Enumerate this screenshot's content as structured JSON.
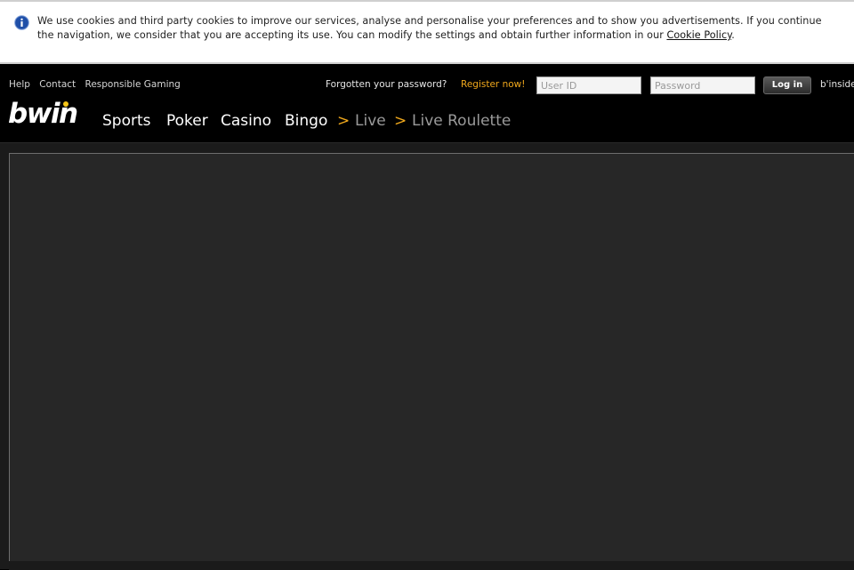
{
  "cookie_banner": {
    "text": "We use cookies and third party cookies to improve our services, analyse and personalise your preferences and to show you advertisements. If you continue the navigation, we consider that you are accepting its use. You can modify the settings and obtain further information in our ",
    "link_label": "Cookie Policy",
    "suffix": "."
  },
  "header": {
    "utility_links": [
      "Help",
      "Contact",
      "Responsible Gaming"
    ],
    "forgot_password": "Forgotten your password?",
    "register": "Register now!",
    "userid_placeholder": "User ID",
    "password_placeholder": "Password",
    "login_label": "Log in",
    "binside": "b'inside"
  },
  "logo": {
    "text": "bwin"
  },
  "nav": {
    "items": [
      "Sports",
      "Poker",
      "Casino",
      "Bingo"
    ],
    "separator": ">",
    "breadcrumb": [
      "Live",
      "Live Roulette"
    ]
  },
  "colors": {
    "accent": "#f0a81c",
    "logo_dot": "#f5c518",
    "background": "#000000",
    "content_bg": "#272727"
  },
  "icons": {
    "info": "info-icon"
  }
}
